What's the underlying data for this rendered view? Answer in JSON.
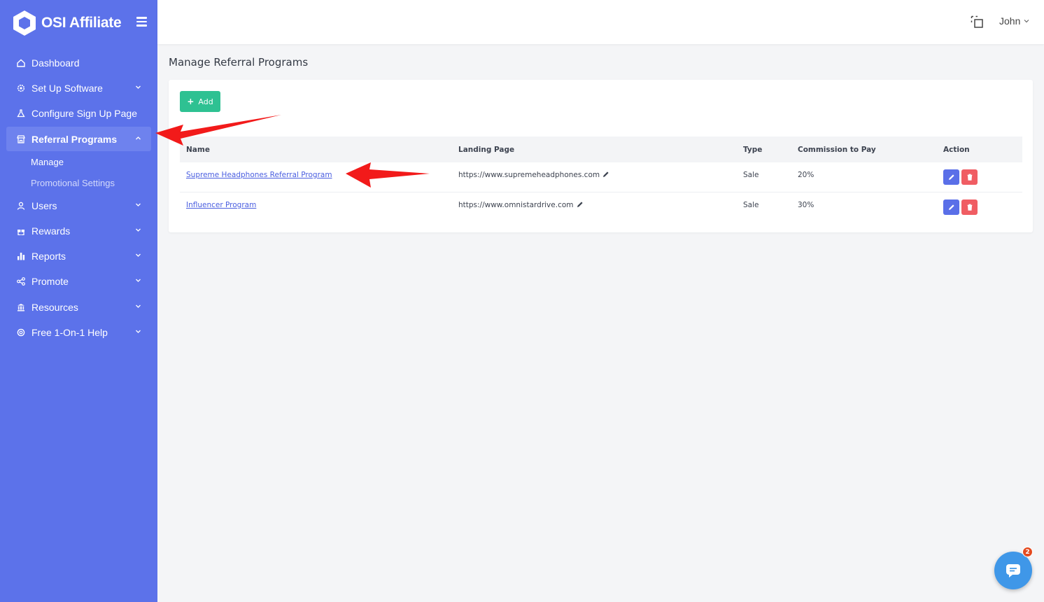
{
  "brand": {
    "name": "OSI Affiliate"
  },
  "topbar": {
    "user_name": "John"
  },
  "sidebar": {
    "items": [
      {
        "label": "Dashboard",
        "icon": "home-icon"
      },
      {
        "label": "Set Up Software",
        "icon": "gear-icon"
      },
      {
        "label": "Configure Sign Up Page",
        "icon": "flask-icon"
      },
      {
        "label": "Referral Programs",
        "icon": "store-icon"
      },
      {
        "label": "Users",
        "icon": "user-icon"
      },
      {
        "label": "Rewards",
        "icon": "gift-icon"
      },
      {
        "label": "Reports",
        "icon": "bar-chart-icon"
      },
      {
        "label": "Promote",
        "icon": "share-icon"
      },
      {
        "label": "Resources",
        "icon": "bank-icon"
      },
      {
        "label": "Free 1-On-1 Help",
        "icon": "lifebuoy-icon"
      }
    ],
    "sub_items": [
      {
        "label": "Manage"
      },
      {
        "label": "Promotional Settings"
      }
    ]
  },
  "main": {
    "title": "Manage Referral Programs",
    "add_label": "Add",
    "columns": [
      "Name",
      "Landing Page",
      "Type",
      "Commission to Pay",
      "Action"
    ],
    "rows": [
      {
        "name": "Supreme Headphones Referral Program",
        "landing": "https://www.supremeheadphones.com",
        "type": "Sale",
        "commission": "20%"
      },
      {
        "name": "Influencer Program",
        "landing": "https://www.omnistardrive.com",
        "type": "Sale",
        "commission": "30%"
      }
    ]
  },
  "chat": {
    "badge_count": "2"
  },
  "colors": {
    "sidebar": "#5c72ea",
    "add_button": "#2ec192",
    "edit_button": "#5a6fe8",
    "delete_button": "#f05d63",
    "annotation_arrow": "#f21a1a"
  }
}
